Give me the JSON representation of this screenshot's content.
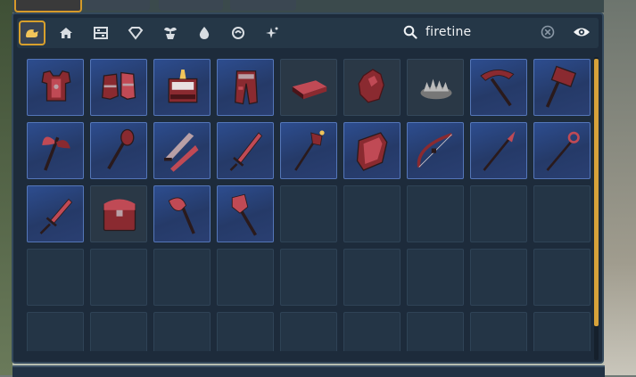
{
  "search": {
    "query": "firetine"
  },
  "categories": [
    {
      "name": "favorites-icon",
      "active": true
    },
    {
      "name": "home-icon",
      "active": false
    },
    {
      "name": "furniture-icon",
      "active": false
    },
    {
      "name": "gem-icon",
      "active": false
    },
    {
      "name": "plant-icon",
      "active": false
    },
    {
      "name": "water-drop-icon",
      "active": false
    },
    {
      "name": "swirl-icon",
      "active": false
    },
    {
      "name": "sparkle-icon",
      "active": false
    }
  ],
  "inventory": {
    "columns": 9,
    "visible_rows": 5,
    "items": [
      {
        "name": "chestplate-armor-icon",
        "style": "filled"
      },
      {
        "name": "boots-armor-icon",
        "style": "filled"
      },
      {
        "name": "crafting-station-icon",
        "style": "filled"
      },
      {
        "name": "leggings-armor-icon",
        "style": "filled"
      },
      {
        "name": "firetine-bar-icon",
        "style": "dark"
      },
      {
        "name": "firetine-ore-icon",
        "style": "dark"
      },
      {
        "name": "spiked-trap-icon",
        "style": "dark"
      },
      {
        "name": "pickaxe-icon",
        "style": "filled"
      },
      {
        "name": "hammer-icon",
        "style": "filled"
      },
      {
        "name": "double-axe-icon",
        "style": "filled"
      },
      {
        "name": "mace-icon",
        "style": "filled"
      },
      {
        "name": "dual-blades-icon",
        "style": "filled"
      },
      {
        "name": "sword-icon",
        "style": "filled"
      },
      {
        "name": "staff-icon",
        "style": "filled"
      },
      {
        "name": "shield-icon",
        "style": "filled"
      },
      {
        "name": "bow-icon",
        "style": "filled"
      },
      {
        "name": "spear-icon",
        "style": "filled"
      },
      {
        "name": "scepter-icon",
        "style": "filled"
      },
      {
        "name": "short-sword-icon",
        "style": "filled"
      },
      {
        "name": "storage-chest-icon",
        "style": "dark"
      },
      {
        "name": "axe-icon",
        "style": "filled"
      },
      {
        "name": "shovel-icon",
        "style": "filled"
      }
    ]
  }
}
